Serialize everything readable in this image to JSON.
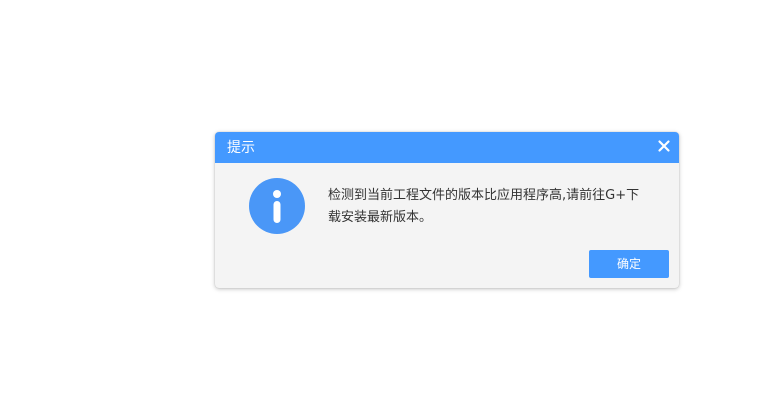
{
  "dialog": {
    "title": "提示",
    "message": "检测到当前工程文件的版本比应用程序高,请前往G+下载安装最新版本。",
    "ok_label": "确定",
    "close_icon": "close-icon",
    "info_icon": "info-icon"
  },
  "colors": {
    "accent": "#4499ff",
    "dialog_background": "#f4f4f4",
    "text": "#333333"
  }
}
